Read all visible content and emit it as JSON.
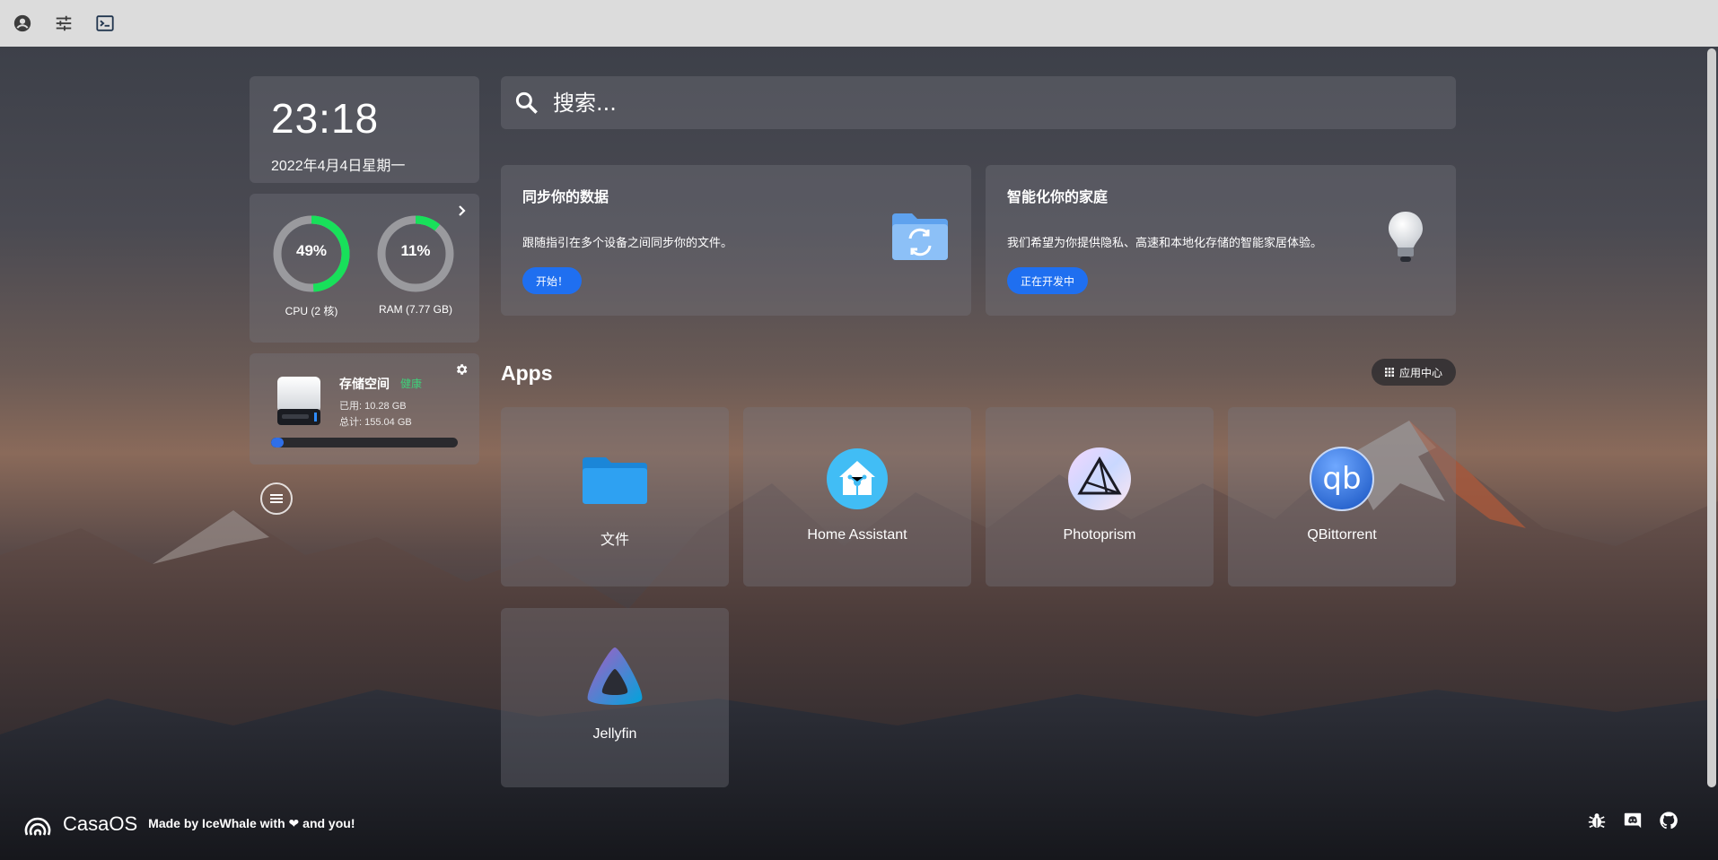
{
  "topbar": {
    "icons": [
      "account-icon",
      "settings-sliders-icon",
      "terminal-icon"
    ]
  },
  "clock": {
    "time": "23:18",
    "date": "2022年4月4日星期一"
  },
  "system": {
    "cpu_percent": "49%",
    "cpu_value": 49,
    "cpu_label": "CPU (2 核)",
    "ram_percent": "11%",
    "ram_value": 11,
    "ram_label": "RAM (7.77 GB)",
    "ring_color": "#18e05a"
  },
  "storage": {
    "title": "存储空间",
    "status": "健康",
    "used": "已用: 10.28 GB",
    "total": "总计: 155.04 GB",
    "used_fraction": 0.066
  },
  "search": {
    "placeholder": "搜索..."
  },
  "cards": [
    {
      "title": "同步你的数据",
      "description": "跟随指引在多个设备之间同步你的文件。",
      "button": "开始！"
    },
    {
      "title": "智能化你的家庭",
      "description": "我们希望为你提供隐私、高速和本地化存储的智能家居体验。",
      "button": "正在开发中"
    }
  ],
  "apps": {
    "heading": "Apps",
    "store_button": "应用中心",
    "items": [
      {
        "name": "文件",
        "icon": "folder-icon"
      },
      {
        "name": "Home Assistant",
        "icon": "home-assistant-icon"
      },
      {
        "name": "Photoprism",
        "icon": "photoprism-icon"
      },
      {
        "name": "QBittorrent",
        "icon": "qbittorrent-icon"
      },
      {
        "name": "Jellyfin",
        "icon": "jellyfin-icon"
      }
    ]
  },
  "footer": {
    "brand": "CasaOS",
    "made_prefix": "Made by IceWhale with",
    "made_suffix": "and you!",
    "links": [
      "bug-icon",
      "discord-icon",
      "github-icon"
    ]
  },
  "colors": {
    "accent": "#1f6ff0",
    "healthy": "#3fd07a",
    "storage_fill": "#2f6fe8"
  }
}
